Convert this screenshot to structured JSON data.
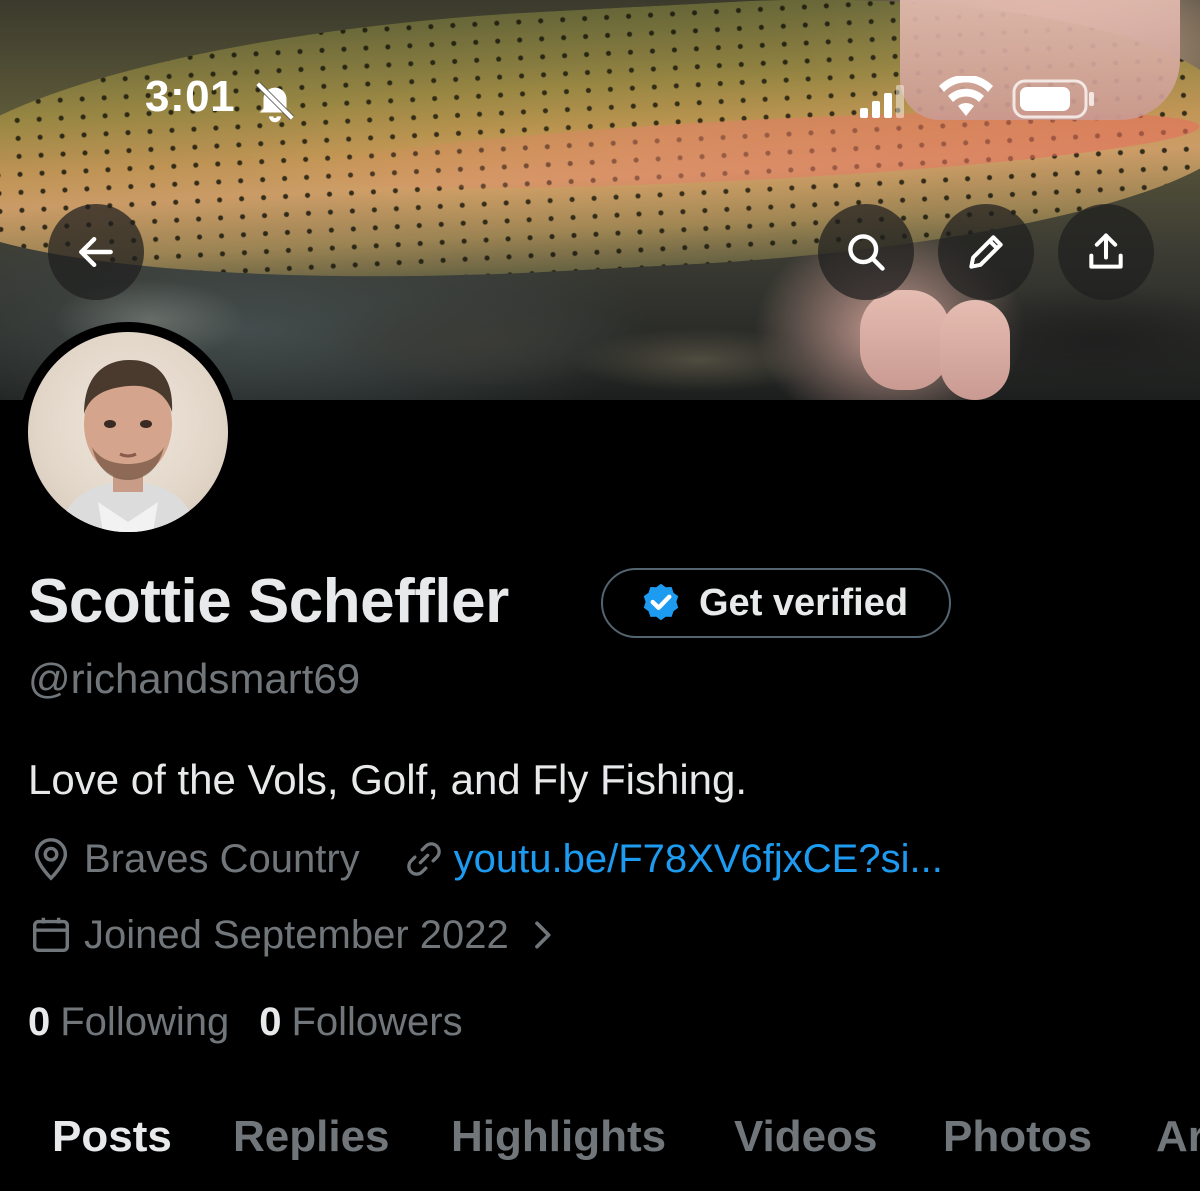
{
  "status_bar": {
    "time": "3:01"
  },
  "header_actions": {
    "back": "back-arrow-icon",
    "search": "search-icon",
    "edit": "pencil-icon",
    "share": "share-icon"
  },
  "profile": {
    "name": "Scottie Scheffler",
    "verify_button": "Get verified",
    "handle": "@richandsmart69",
    "bio": "Love of the Vols, Golf, and Fly Fishing.",
    "location": "Braves Country",
    "link": "youtu.be/F78XV6fjxCE?si...",
    "joined": "Joined September 2022",
    "following_count": "0",
    "following_label": "Following",
    "followers_count": "0",
    "followers_label": "Followers"
  },
  "tabs": [
    {
      "label": "Posts",
      "active": true
    },
    {
      "label": "Replies",
      "active": false
    },
    {
      "label": "Highlights",
      "active": false
    },
    {
      "label": "Videos",
      "active": false
    },
    {
      "label": "Photos",
      "active": false
    },
    {
      "label": "Ar",
      "active": false
    }
  ],
  "colors": {
    "background": "#000000",
    "text_primary": "#e7e9ea",
    "text_secondary": "#71767b",
    "link": "#1d9bf0",
    "verified_badge": "#1d9bf0"
  }
}
